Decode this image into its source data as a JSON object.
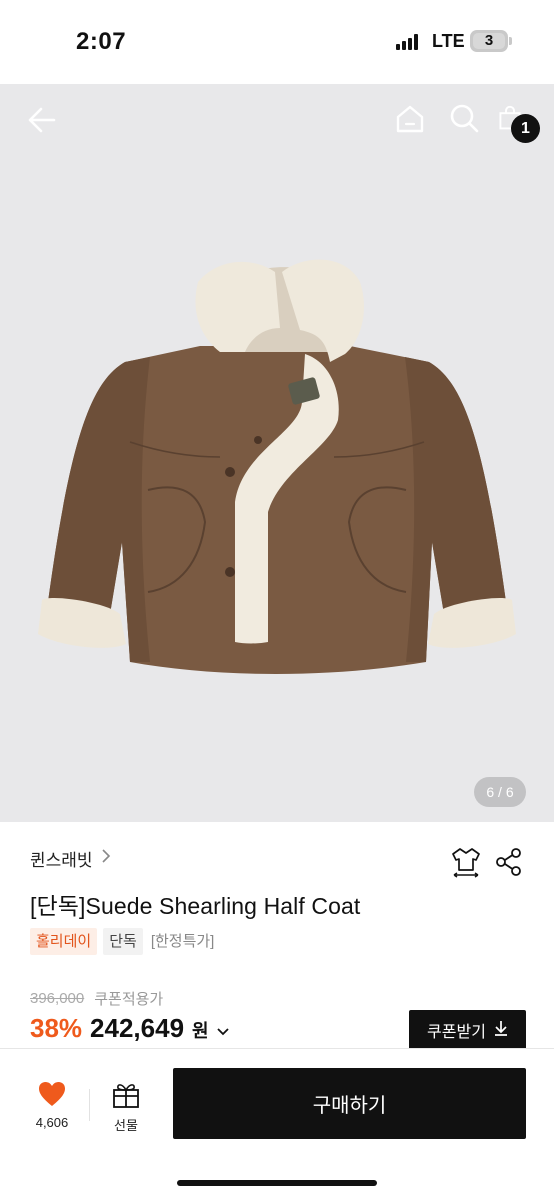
{
  "status_bar": {
    "time": "2:07",
    "network": "LTE",
    "battery": "3"
  },
  "header": {
    "icons": [
      "arrow-left-icon",
      "home-icon",
      "search-icon",
      "shopping-bag-icon"
    ],
    "cart_count": "1"
  },
  "gallery": {
    "page_indicator": "6 / 6",
    "image": "brown-suede-shearling-jacket"
  },
  "product": {
    "brand": "퀸스래빗",
    "title": "[단독]Suede Shearling Half Coat",
    "tags": {
      "holiday": "홀리데이",
      "exclusive": "단독",
      "limited": "[한정특가]"
    },
    "original_price": "396,000",
    "coupon_note": "쿠폰적용가",
    "discount_rate": "38%",
    "sale_price": "242,649",
    "currency": "원",
    "coupon_button": "쿠폰받기"
  },
  "bottom_bar": {
    "like_count": "4,606",
    "gift_label": "선물",
    "buy_label": "구매하기"
  },
  "colors": {
    "accent": "#ef5a1c",
    "tag_bg": "#fdeee6",
    "dark": "#111111",
    "hero_bg": "#e8e8ea"
  }
}
